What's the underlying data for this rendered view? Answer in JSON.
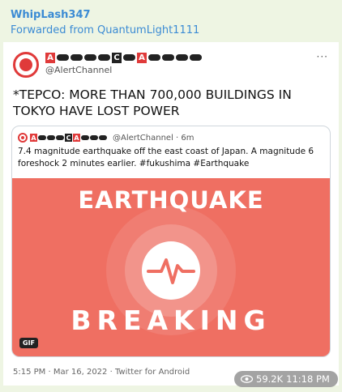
{
  "message": {
    "sender": "WhipLash347",
    "forwarded": "Forwarded from QuantumLight1111",
    "views": "59.2K",
    "time": "11:18 PM"
  },
  "tweet": {
    "logo_letters": [
      "A",
      "C",
      "A"
    ],
    "handle": "@AlertChannel",
    "more": "···",
    "headline": "*TEPCO: MORE THAN 700,000 BUILDINGS IN TOKYO HAVE LOST POWER",
    "meta": "5:15 PM · Mar 16, 2022 · Twitter for Android",
    "quoted": {
      "handle_time": "@AlertChannel · 6m",
      "text": "7.4 magnitude earthquake off the east coast of Japan. A magnitude 6 foreshock 2 minutes earlier. #fukushima #Earthquake",
      "media": {
        "top_text": "EARTHQUAKE",
        "bottom_text": "BREAKING",
        "badge": "GIF",
        "bg_color": "#ef6f62"
      }
    }
  }
}
